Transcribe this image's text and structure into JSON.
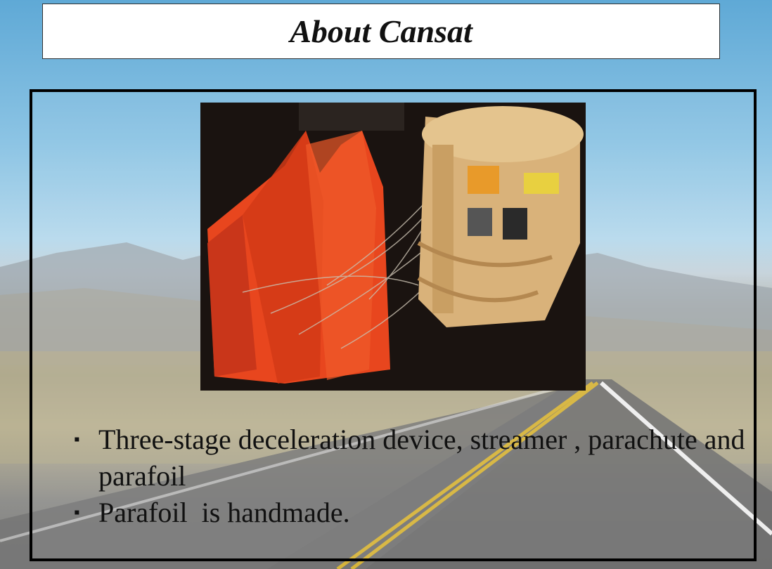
{
  "slide": {
    "title": "About Cansat",
    "bullets": [
      {
        "mark": "▪",
        "text": "Three-stage deceleration device, streamer , parachute and parafoil"
      },
      {
        "mark": "▪",
        "text": "Parafoil  is handmade."
      }
    ]
  },
  "colors": {
    "parafoil": "#e8461e",
    "wood": "#d9b27a",
    "sky": "#8cc4e4"
  }
}
